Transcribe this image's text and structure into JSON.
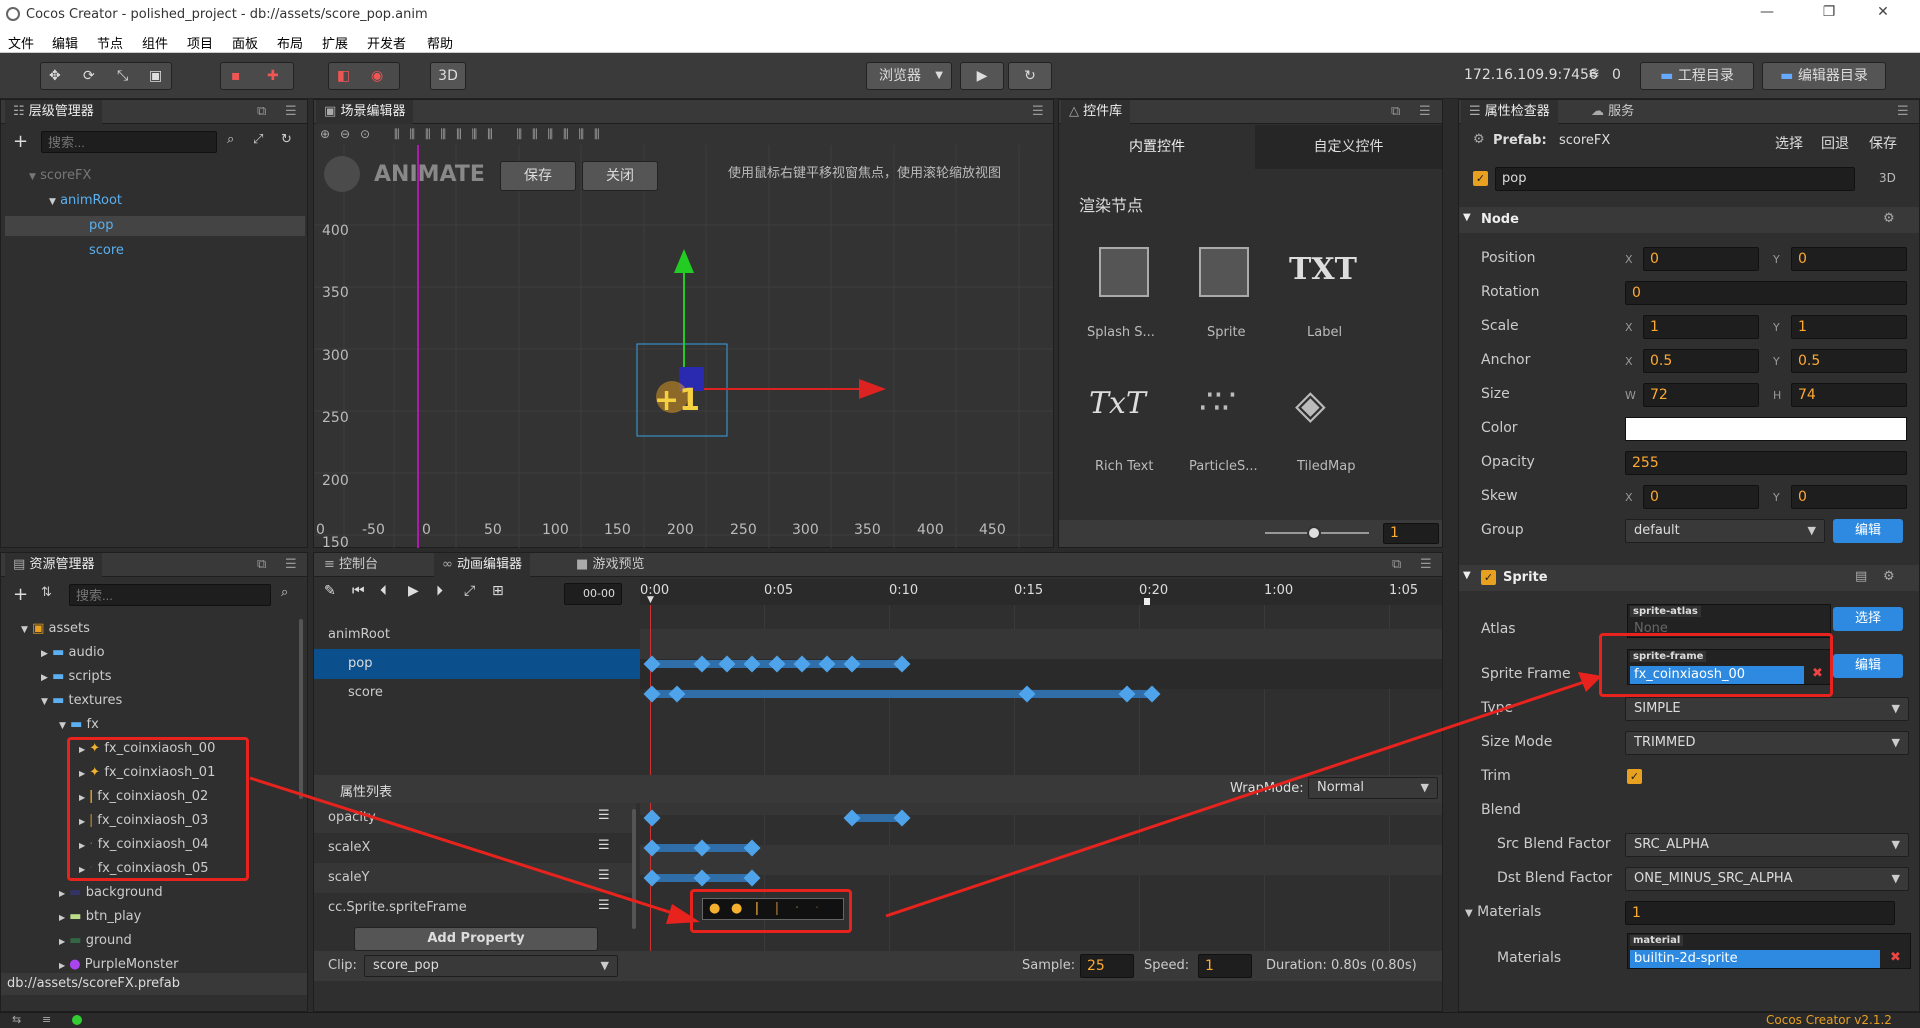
{
  "window": {
    "title": "Cocos Creator - polished_project - db://assets/score_pop.anim",
    "min": "—",
    "restore": "❐",
    "close": "✕"
  },
  "menu": [
    "文件",
    "编辑",
    "节点",
    "组件",
    "项目",
    "面板",
    "布局",
    "扩展",
    "开发者",
    "帮助"
  ],
  "toolbar": {
    "browser": "浏览器",
    "three_d": "3D",
    "ip": "172.16.109.9:7456",
    "conn_count": "0",
    "project_dir": "工程目录",
    "editor_dir": "编辑器目录"
  },
  "hierarchy": {
    "title": "层级管理器",
    "search_placeholder": "搜索...",
    "items": [
      {
        "label": "scoreFX",
        "depth": 0,
        "muted": true,
        "arrow": "▼"
      },
      {
        "label": "animRoot",
        "depth": 1,
        "arrow": "▼"
      },
      {
        "label": "pop",
        "depth": 2,
        "selected": true
      },
      {
        "label": "score",
        "depth": 2
      }
    ]
  },
  "scene": {
    "title": "场景编辑器",
    "animate": "ANIMATE",
    "save": "保存",
    "close": "关闭",
    "hint": "使用鼠标右键平移视窗焦点，使用滚轮缩放视图",
    "y_ticks": [
      "400",
      "350",
      "300",
      "250",
      "200",
      "150"
    ],
    "x_ticks": [
      "0",
      "-50",
      "0",
      "50",
      "100",
      "150",
      "200",
      "250",
      "300",
      "350",
      "400",
      "450"
    ]
  },
  "widgets": {
    "title": "控件库",
    "tab_builtin": "内置控件",
    "tab_custom": "自定义控件",
    "section": "渲染节点",
    "items": [
      "Splash S...",
      "Sprite",
      "Label",
      "Rich Text",
      "ParticleS...",
      "TiledMap"
    ],
    "zoom": "1"
  },
  "inspector": {
    "title": "属性检查器",
    "service": "服务",
    "prefab_label": "Prefab:",
    "prefab_name": "scoreFX",
    "select": "选择",
    "revert": "回退",
    "save": "保存",
    "node_name": "pop",
    "three_d": "3D",
    "node_section": "Node",
    "position": {
      "label": "Position",
      "x": "0",
      "y": "0"
    },
    "rotation": {
      "label": "Rotation",
      "value": "0"
    },
    "scale": {
      "label": "Scale",
      "x": "1",
      "y": "1"
    },
    "anchor": {
      "label": "Anchor",
      "x": "0.5",
      "y": "0.5"
    },
    "size": {
      "label": "Size",
      "w": "72",
      "h": "74"
    },
    "color": {
      "label": "Color",
      "value": "#ffffff"
    },
    "opacity": {
      "label": "Opacity",
      "value": "255"
    },
    "skew": {
      "label": "Skew",
      "x": "0",
      "y": "0"
    },
    "group": {
      "label": "Group",
      "value": "default",
      "edit": "编辑"
    },
    "sprite_section": "Sprite",
    "atlas": {
      "label": "Atlas",
      "tag": "sprite-atlas",
      "value": "None",
      "btn": "选择"
    },
    "sprite_frame": {
      "label": "Sprite Frame",
      "tag": "sprite-frame",
      "value": "fx_coinxiaosh_00",
      "btn": "编辑"
    },
    "type": {
      "label": "Type",
      "value": "SIMPLE"
    },
    "size_mode": {
      "label": "Size Mode",
      "value": "TRIMMED"
    },
    "trim": {
      "label": "Trim"
    },
    "blend": {
      "label": "Blend"
    },
    "src_blend": {
      "label": "Src Blend Factor",
      "value": "SRC_ALPHA"
    },
    "dst_blend": {
      "label": "Dst Blend Factor",
      "value": "ONE_MINUS_SRC_ALPHA"
    },
    "materials": {
      "label": "Materials",
      "count": "1",
      "item_label": "Materials",
      "tag": "material",
      "value": "builtin-2d-sprite"
    },
    "axis_x": "X",
    "axis_y": "Y",
    "axis_w": "W",
    "axis_h": "H"
  },
  "assets": {
    "title": "资源管理器",
    "search_placeholder": "搜索...",
    "items": [
      {
        "label": "assets",
        "depth": 0,
        "arrow": "▼",
        "icon": "db"
      },
      {
        "label": "audio",
        "depth": 1,
        "arrow": "▶",
        "icon": "folder"
      },
      {
        "label": "scripts",
        "depth": 1,
        "arrow": "▶",
        "icon": "folder"
      },
      {
        "label": "textures",
        "depth": 1,
        "arrow": "▼",
        "icon": "folder"
      },
      {
        "label": "fx",
        "depth": 2,
        "arrow": "▼",
        "icon": "folder"
      },
      {
        "label": "fx_coinxiaosh_00",
        "depth": 3,
        "arrow": "▶",
        "icon": "spark"
      },
      {
        "label": "fx_coinxiaosh_01",
        "depth": 3,
        "arrow": "▶",
        "icon": "spark"
      },
      {
        "label": "fx_coinxiaosh_02",
        "depth": 3,
        "arrow": "▶",
        "icon": "spark"
      },
      {
        "label": "fx_coinxiaosh_03",
        "depth": 3,
        "arrow": "▶",
        "icon": "spark"
      },
      {
        "label": "fx_coinxiaosh_04",
        "depth": 3,
        "arrow": "▶",
        "icon": "spark"
      },
      {
        "label": "fx_coinxiaosh_05",
        "depth": 3,
        "arrow": "▶",
        "icon": "spark"
      },
      {
        "label": "background",
        "depth": 2,
        "arrow": "▶",
        "icon": "img"
      },
      {
        "label": "btn_play",
        "depth": 2,
        "arrow": "▶",
        "icon": "img"
      },
      {
        "label": "ground",
        "depth": 2,
        "arrow": "▶",
        "icon": "img"
      },
      {
        "label": "PurpleMonster",
        "depth": 2,
        "arrow": "▶",
        "icon": "monster"
      }
    ],
    "path": "db://assets/scoreFX.prefab"
  },
  "anim": {
    "tab_console": "控制台",
    "tab_anim": "动画编辑器",
    "tab_preview": "游戏预览",
    "time_field": "00-00",
    "ruler": [
      "0:00",
      "0:05",
      "0:10",
      "0:15",
      "0:20",
      "1:00",
      "1:05"
    ],
    "nodes": [
      "animRoot",
      "pop",
      "score"
    ],
    "prop_list": "属性列表",
    "wrapmode_label": "WrapMode:",
    "wrapmode": "Normal",
    "props": [
      "opacity",
      "scaleX",
      "scaleY",
      "cc.Sprite.spriteFrame"
    ],
    "add_property": "Add Property",
    "clip_label": "Clip:",
    "clip": "score_pop",
    "sample_label": "Sample:",
    "sample": "25",
    "speed_label": "Speed:",
    "speed": "1",
    "duration": "Duration: 0.80s (0.80s)"
  },
  "status": {
    "version": "Cocos Creator v2.1.2"
  },
  "colors": {
    "accent": "#2d8ae0",
    "annotation": "#e8231d",
    "keyframe": "#4fa3ea",
    "version": "#e8a020"
  }
}
